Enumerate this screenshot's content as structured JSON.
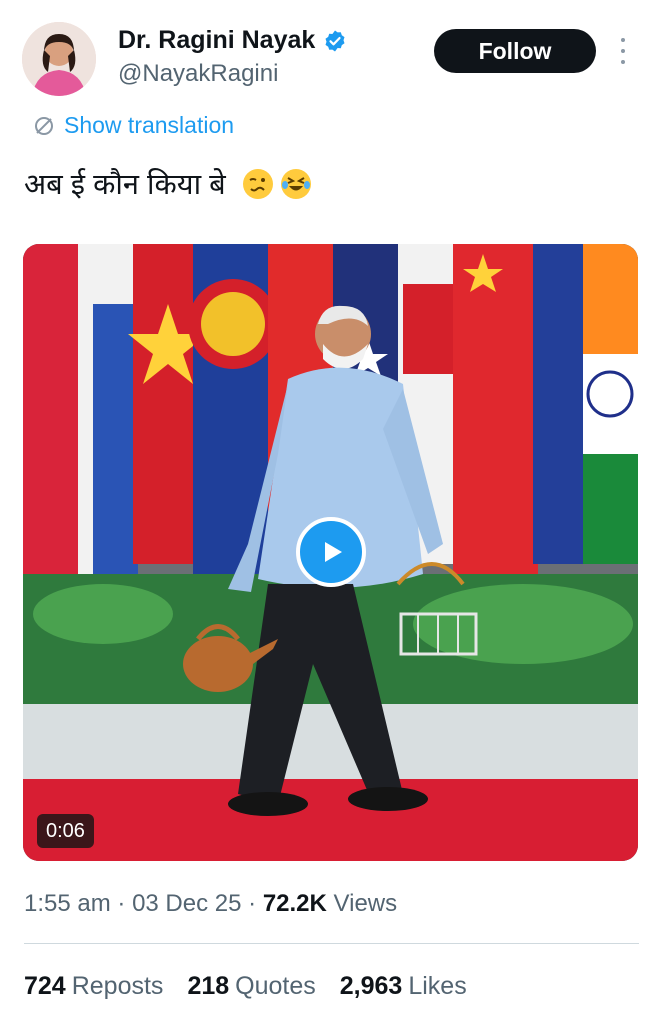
{
  "author": {
    "name": "Dr. Ragini Nayak",
    "handle": "@NayakRagini",
    "verified": true,
    "avatar": "avatar"
  },
  "header": {
    "follow_label": "Follow",
    "more_icon": "more-vertical-icon"
  },
  "translation": {
    "label": "Show translation",
    "icon": "translate-icon"
  },
  "tweet": {
    "text": "अब ई कौन किया बे",
    "emojis": [
      "woozy-face-emoji",
      "rolling-on-floor-laughing-emoji"
    ]
  },
  "media": {
    "type": "video",
    "duration": "0:06",
    "play_icon": "play-icon"
  },
  "meta": {
    "time": "1:55 am",
    "date": "03 Dec 25",
    "views_count": "72.2K",
    "views_label": "Views"
  },
  "stats": [
    {
      "count": "724",
      "label": "Reposts"
    },
    {
      "count": "218",
      "label": "Quotes"
    },
    {
      "count": "2,963",
      "label": "Likes"
    }
  ],
  "colors": {
    "accent": "#1d9bf0",
    "text": "#0f1419",
    "secondary": "#536471",
    "follow_bg": "#0f1419"
  }
}
